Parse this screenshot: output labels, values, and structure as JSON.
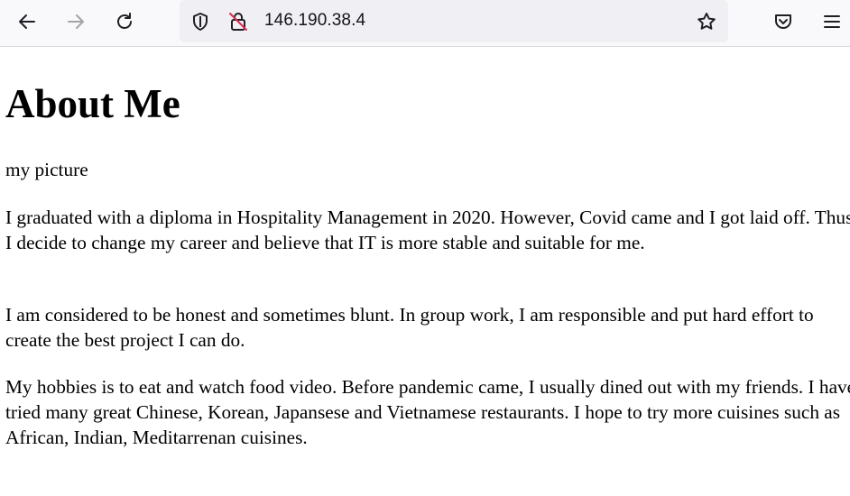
{
  "browser": {
    "url": "146.190.38.4"
  },
  "page": {
    "heading": "About Me",
    "image_alt": "my picture",
    "paragraphs": [
      "I graduated with a diploma in Hospitality Management in 2020. However, Covid came and I got laid off. Thus, I decide to change my career and believe that IT is more stable and suitable for me.",
      "I am considered to be honest and sometimes blunt. In group work, I am responsible and put hard effort to create the best project I can do.",
      "My hobbies is to eat and watch food video. Before pandemic came, I usually dined out with my friends. I have tried many great Chinese, Korean, Japansese and Vietnamese restaurants. I hope to try more cuisines such as African, Indian, Meditarrenan cuisines."
    ]
  }
}
